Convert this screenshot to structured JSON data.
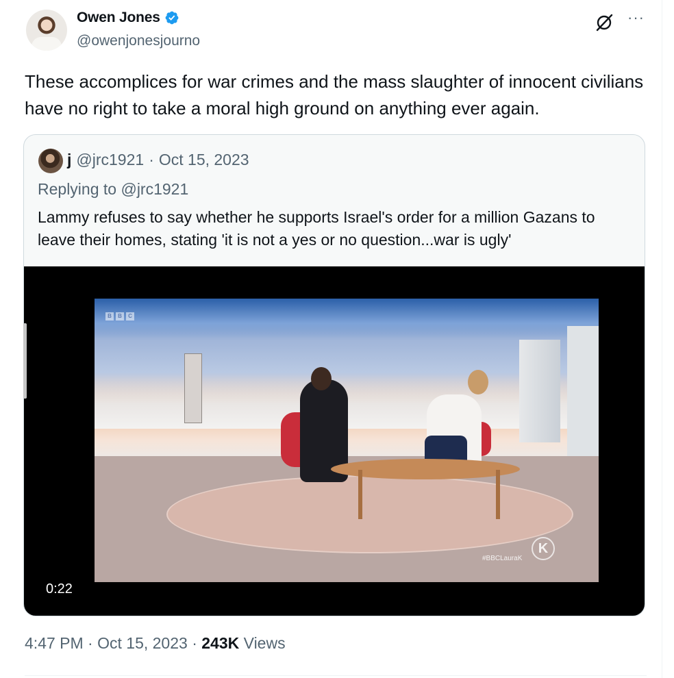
{
  "author": {
    "display_name": "Owen Jones",
    "handle": "@owenjonesjourno",
    "verified_icon": "verified-badge-icon"
  },
  "toolbar": {
    "grok_icon": "grok-icon",
    "more_label": "···"
  },
  "tweet": {
    "text": "These accomplices for war crimes and the mass slaughter of innocent civilians have no right to take a moral high ground on anything ever again."
  },
  "quote": {
    "display_name": "j",
    "handle": "@jrc1921",
    "separator": "·",
    "date": "Oct 15, 2023",
    "replying_prefix": "Replying to",
    "replying_handle": "@jrc1921",
    "text": "Lammy refuses to say whether he supports Israel's order for a million Gazans to leave their homes, stating 'it is not a yes or no question...war is ugly'",
    "video": {
      "duration": "0:22",
      "logo_letters": [
        "B",
        "B",
        "C"
      ],
      "watermark": "K",
      "hashtag": "#BBCLauraK"
    }
  },
  "meta": {
    "time": "4:47 PM",
    "sep1": " · ",
    "date": "Oct 15, 2023",
    "sep2": " · ",
    "views_count": "243K",
    "views_label": " Views"
  },
  "colors": {
    "text_primary": "#0f1419",
    "text_secondary": "#536471",
    "verified_blue": "#1d9bf0",
    "border": "#cfd9de"
  }
}
